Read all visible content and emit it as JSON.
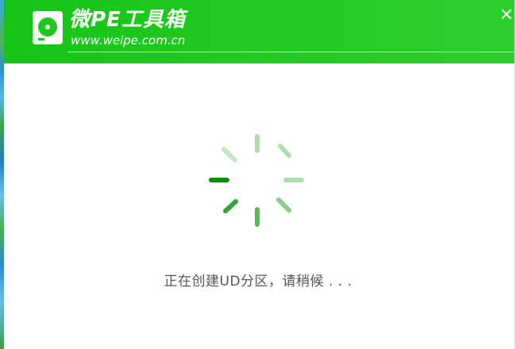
{
  "header": {
    "title": "微PE工具箱",
    "url": "www.weipe.com.cn",
    "logo_icon": "disk-icon",
    "close_icon": "close-icon",
    "color": "#1ec81e"
  },
  "main": {
    "spinner_icon": "loading-spinner-icon",
    "status": "正在创建UD分区，请稍候 . . ."
  }
}
